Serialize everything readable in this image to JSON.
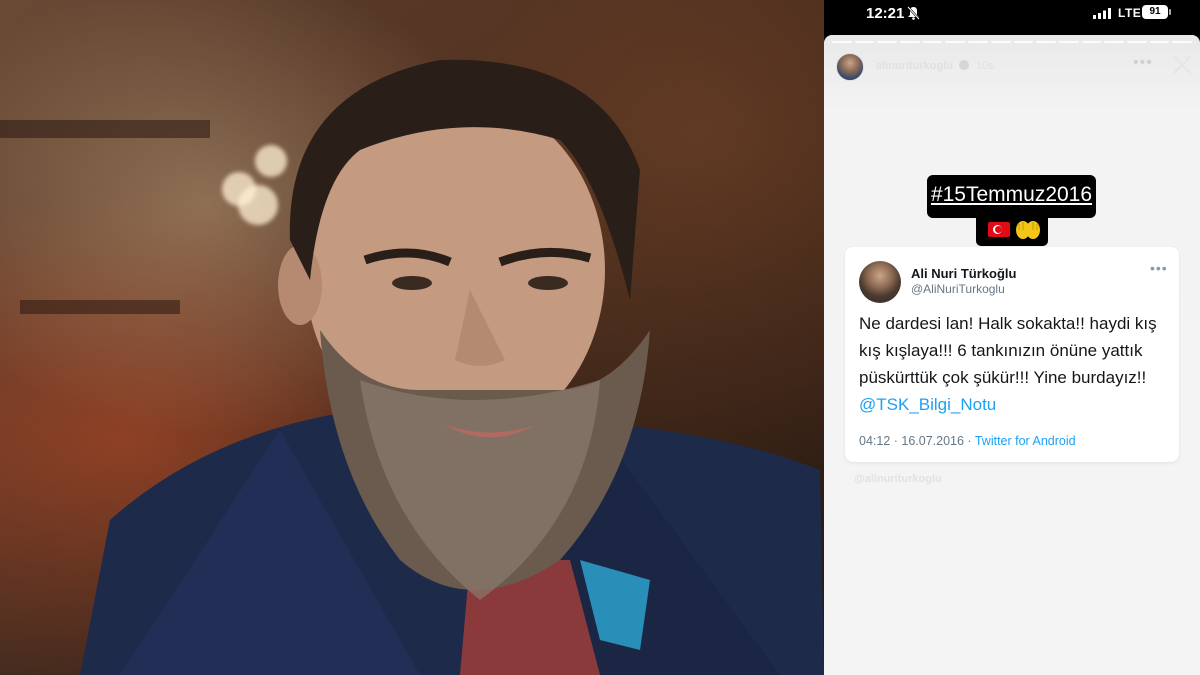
{
  "status_bar": {
    "time": "12:21",
    "network": "LTE",
    "battery": "91",
    "bell_icon": "bell-muted-icon",
    "signal_icon": "cellular-signal-icon"
  },
  "story": {
    "username": "alinuriturkoglu",
    "time_ago": "10s",
    "verified_icon": "verified-badge-icon",
    "more_icon": "more-dots-icon",
    "close_icon": "close-icon",
    "hashtag": "#15Temmuz2016",
    "emojis": [
      "turkish-flag-icon",
      "raised-hands-icon"
    ],
    "watermark": "@alinuriturkoglu"
  },
  "tweet": {
    "display_name": "Ali Nuri Türkoğlu",
    "handle": "@AliNuriTurkoglu",
    "text": "Ne dardesi lan! Halk sokakta!! haydi kış kış kışlaya!!!  6 tankınızın önüne yattık püskürttük çok şükür!!! Yine burdayız!! ",
    "mention": "@TSK_Bilgi_Notu",
    "timestamp": "04:12 · 16.07.2016 · ",
    "source": "Twitter for Android"
  },
  "colors": {
    "mention": "#1da1f2",
    "flag": "#e30a17",
    "story_bg": "#f4f4f4"
  }
}
